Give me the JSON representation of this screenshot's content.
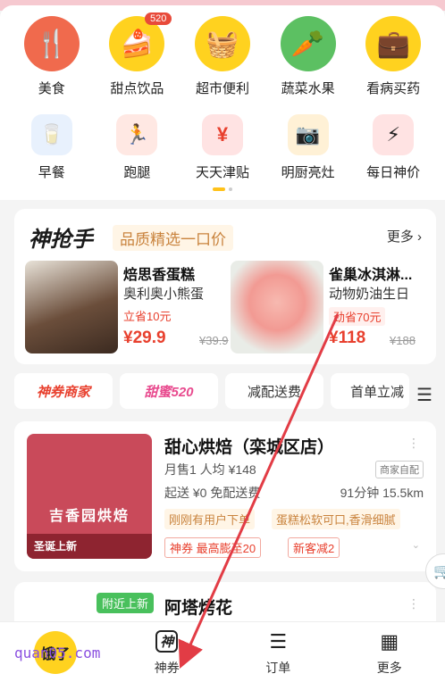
{
  "categories_row1": [
    {
      "label": "美食",
      "icon": "utensils-icon",
      "glyph": "🍴",
      "bg": "#f06a4d"
    },
    {
      "label": "甜点饮品",
      "icon": "dessert-icon",
      "glyph": "🍰",
      "bg": "#ffd21f",
      "badge": "520"
    },
    {
      "label": "超市便利",
      "icon": "basket-icon",
      "glyph": "🧺",
      "bg": "#ffd21f"
    },
    {
      "label": "蔬菜水果",
      "icon": "carrot-icon",
      "glyph": "🥕",
      "bg": "#5cc062"
    },
    {
      "label": "看病买药",
      "icon": "medkit-icon",
      "glyph": "💼",
      "bg": "#ffd21f"
    }
  ],
  "categories_row2": [
    {
      "label": "早餐",
      "icon": "milk-icon",
      "glyph": "🥛",
      "bg": "#e8f1fd"
    },
    {
      "label": "跑腿",
      "icon": "runner-icon",
      "glyph": "🏃",
      "bg": "#ffe8e3"
    },
    {
      "label": "天天津贴",
      "icon": "red-envelope-icon",
      "glyph": "¥",
      "bg": "#ffe3e3"
    },
    {
      "label": "明厨亮灶",
      "icon": "camera-icon",
      "glyph": "📷",
      "bg": "#fff1d6"
    },
    {
      "label": "每日神价",
      "icon": "lightning-icon",
      "glyph": "⚡",
      "bg": "#ffe3e3"
    }
  ],
  "grab": {
    "logo": "神抢手",
    "subtitle": "品质精选一口价",
    "more": "更多 ›",
    "products": [
      {
        "name": "焙思香蛋糕",
        "desc": "奥利奥小熊蛋",
        "tag": "立省10元",
        "price": "¥29.9",
        "orig": "¥39.9"
      },
      {
        "name": "雀巢冰淇淋...",
        "desc": "动物奶油生日",
        "tag": "劲省70元",
        "price": "¥118",
        "orig": "¥188"
      }
    ]
  },
  "filters": [
    "神券商家",
    "甜蜜520",
    "减配送费",
    "首单立减"
  ],
  "store": {
    "image_title": "吉香园烘焙",
    "image_footer": "圣诞上新",
    "name": "甜心烘焙（栾城区店）",
    "stats": "月售1 人均 ¥148",
    "self_delivery": "商家自配",
    "delivery": "起送 ¥0 免配送费",
    "time_distance": "91分钟 15.5km",
    "hints": [
      "刚刚有用户下单",
      "蛋糕松软可口,香滑细腻"
    ],
    "coupons": [
      "神券 最高膨至20",
      "新客减2"
    ]
  },
  "store2": {
    "badge": "附近上新",
    "name": "阿塔烤花"
  },
  "tabs": [
    {
      "label": "",
      "icon": "home-icon",
      "glyph": "饿了"
    },
    {
      "label": "神券",
      "icon": "coupon-icon",
      "glyph": "神"
    },
    {
      "label": "订单",
      "icon": "order-icon",
      "glyph": "☰"
    },
    {
      "label": "更多",
      "icon": "grid-icon",
      "glyph": "▦"
    }
  ],
  "watermark": "quan05.com",
  "colors": {
    "brand_yellow": "#ffd21f",
    "price_red": "#e8402e",
    "accent_orange": "#c9833d"
  }
}
